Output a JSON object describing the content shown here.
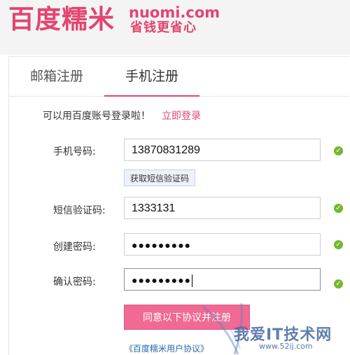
{
  "header": {
    "logo_main": "百度糯米",
    "logo_domain": "nuomi.com",
    "logo_slogan": "省钱更省心"
  },
  "tabs": [
    {
      "label": "邮箱注册",
      "active": false
    },
    {
      "label": "手机注册",
      "active": true
    }
  ],
  "login_prompt": "可以用百度账号登录啦！",
  "login_link": "立即登录",
  "form": {
    "phone_label": "手机号码:",
    "phone_value": "13870831289",
    "get_code_button": "获取短信验证码",
    "sms_label": "短信验证码:",
    "sms_value": "1333131",
    "password_label": "创建密码:",
    "password_value": "●●●●●●●●●",
    "confirm_label": "确认密码:",
    "confirm_value": "●●●●●●●●●"
  },
  "submit_button": "同意以下协议并注册",
  "agreement_link": "《百度糯米用户协议》",
  "watermark": {
    "title": "我爱IT技术网",
    "url": "www.52ij.com"
  },
  "colors": {
    "brand": "#e2456f",
    "button": "#f06a94",
    "valid": "#72b82a",
    "link": "#2a68b0"
  },
  "icons": {
    "valid": "check-circle-icon"
  }
}
